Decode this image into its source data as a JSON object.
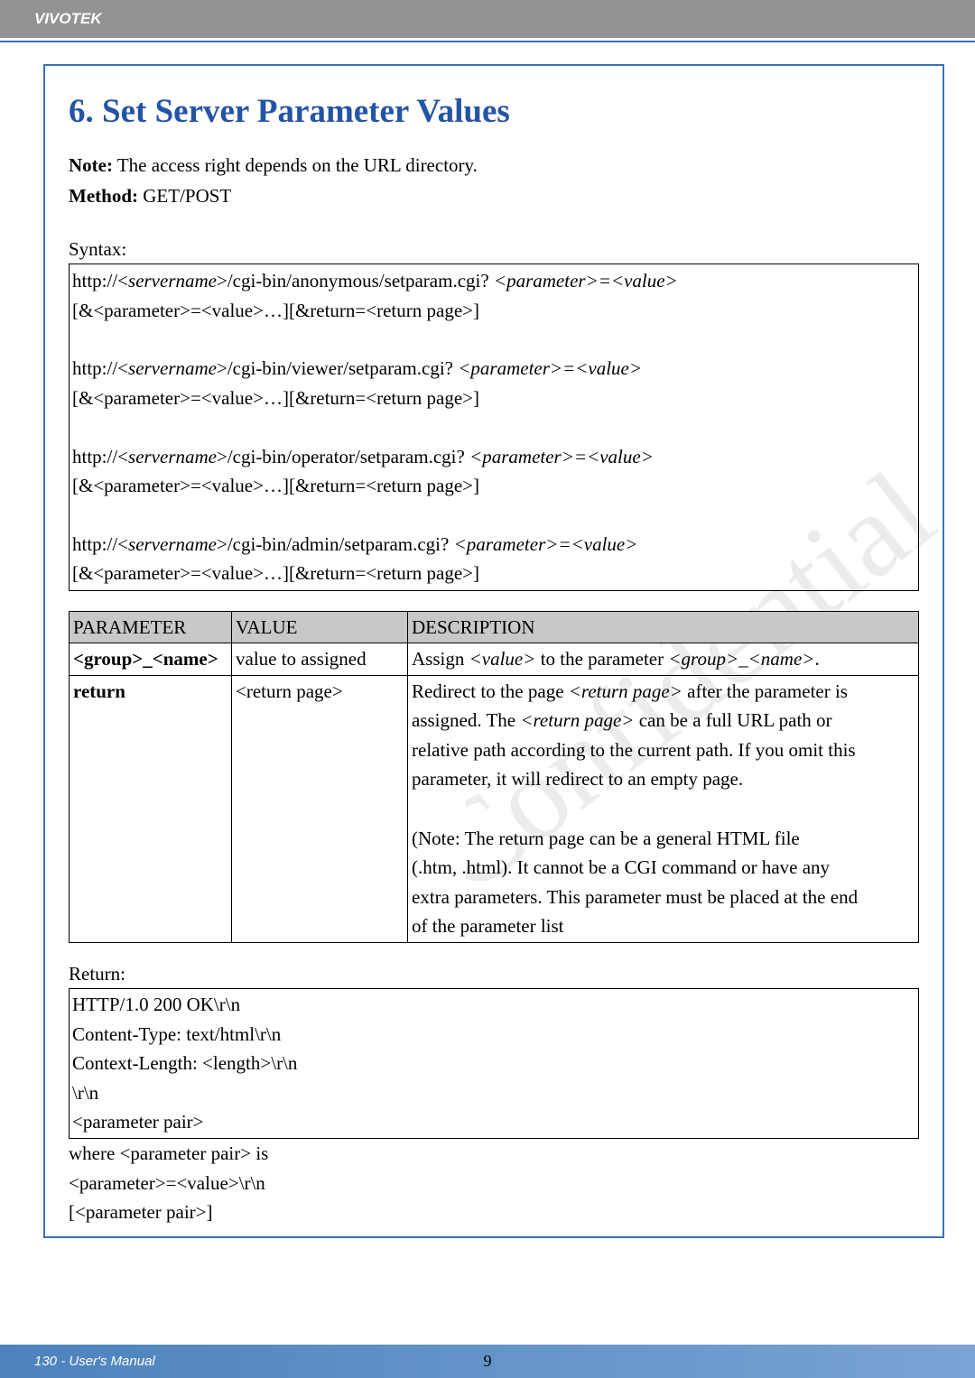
{
  "header": {
    "brand": "VIVOTEK"
  },
  "section": {
    "title": "6. Set Server Parameter Values",
    "note_label": "Note:",
    "note_text": " The access right depends on the URL directory.",
    "method_label": "Method:",
    "method_value": " GET/POST"
  },
  "syntax": {
    "label": "Syntax:",
    "lines": {
      "a1a": "http://<",
      "a1b": "servername",
      "a1c": ">/cgi-bin/anonymous/setparam.cgi? ",
      "a1d": "<parameter>=<value>",
      "a2": "[&<parameter>=<value>…][&return=<return page>]",
      "b1a": "http://<",
      "b1b": "servername",
      "b1c": ">/cgi-bin/viewer/setparam.cgi? ",
      "b1d": "<parameter>=<value>",
      "b2": "[&<parameter>=<value>…][&return=<return page>]",
      "c1a": "http://<",
      "c1b": "servername",
      "c1c": ">/cgi-bin/operator/setparam.cgi? ",
      "c1d": "<parameter>=<value>",
      "c2": "[&<parameter>=<value>…][&return=<return page>]",
      "d1a": "http://<",
      "d1b": "servername",
      "d1c": ">/cgi-bin/admin/setparam.cgi? ",
      "d1d": "<parameter>=<value>",
      "d2": "[&<parameter>=<value>…][&return=<return page>]"
    }
  },
  "table": {
    "headers": {
      "h1": "PARAMETER",
      "h2": "VALUE",
      "h3": "DESCRIPTION"
    },
    "row1": {
      "param": "<group>_<name>",
      "value": "value to assigned",
      "desc_a": "Assign ",
      "desc_b": "<value>",
      "desc_c": " to the parameter ",
      "desc_d": "<group>_<name>",
      "desc_e": "."
    },
    "row2": {
      "param": "return",
      "value": "<return page>",
      "desc1a": "Redirect to the page ",
      "desc1b": "<return page>",
      "desc1c": " after the parameter is",
      "desc2a": "assigned. The ",
      "desc2b": "<return page>",
      "desc2c": " can be a full URL path or",
      "desc3": "relative path according to the current path. If you omit this",
      "desc4": "parameter, it will redirect to an empty page.",
      "desc5": "(Note: The return page can be a general HTML file",
      "desc6": "(.htm, .html). It cannot be a CGI command or have any",
      "desc7": "extra parameters. This parameter must be placed at the end",
      "desc8": "of the parameter list"
    }
  },
  "ret": {
    "label": "Return:",
    "l1": "HTTP/1.0 200 OK\\r\\n",
    "l2": "Content-Type: text/html\\r\\n",
    "l3": "Context-Length: <length>\\r\\n",
    "l4": "\\r\\n",
    "l5": "<parameter pair>",
    "w1": "where <parameter pair> is",
    "w2": "<parameter>=<value>\\r\\n",
    "w3": "[<parameter pair>]"
  },
  "footer": {
    "left": "130 - User's Manual",
    "pagenum": "9"
  }
}
